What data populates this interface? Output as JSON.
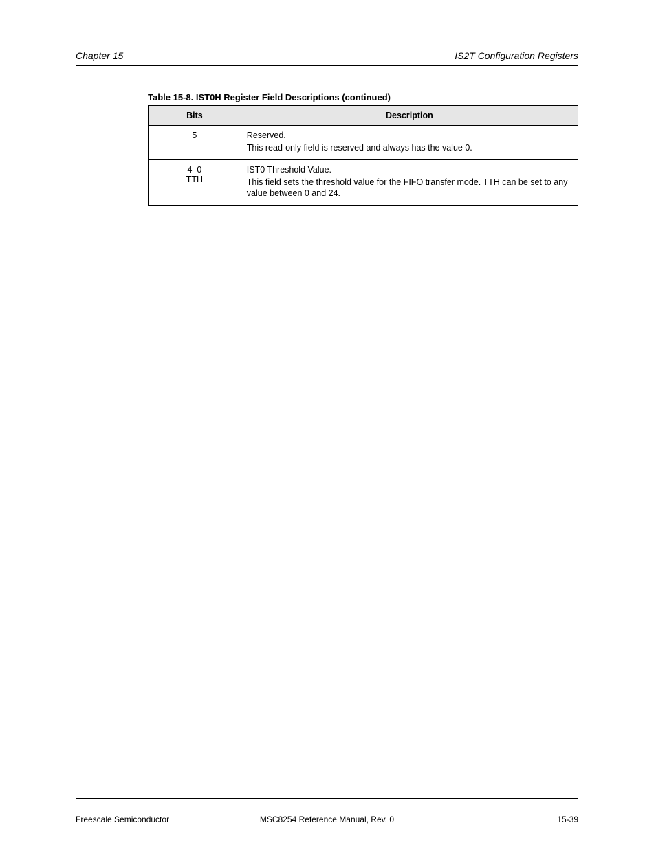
{
  "header": {
    "left": "Chapter 15",
    "right": "IS2T Configuration Registers"
  },
  "table": {
    "caption": "Table 15-8. IST0H Register Field Descriptions (continued)",
    "columns": [
      "Bits",
      "Description"
    ],
    "rows": [
      {
        "bits": "5",
        "desc": [
          "Reserved.",
          "This read-only field is reserved and always has the value 0."
        ]
      },
      {
        "bits": "4–0\nTTH",
        "desc": [
          "IST0 Threshold Value.",
          "This field sets the threshold value for the FIFO transfer mode. TTH can be set to any value between 0 and 24."
        ]
      }
    ]
  },
  "footer": {
    "left": "Freescale Semiconductor",
    "center": "MSC8254 Reference Manual, Rev. 0",
    "right": "15-39"
  }
}
